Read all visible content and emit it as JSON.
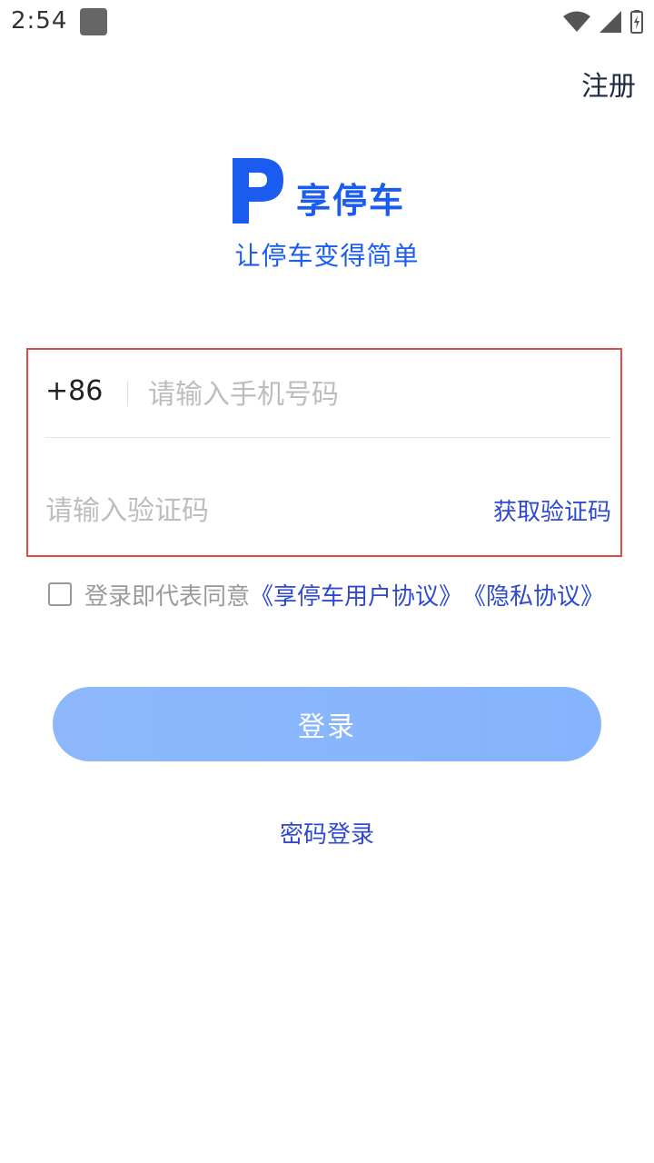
{
  "status_bar": {
    "time": "2:54",
    "icons": [
      "wifi-icon",
      "cellular-signal-icon",
      "battery-charging-icon"
    ]
  },
  "header": {
    "register_label": "注册"
  },
  "brand": {
    "logo_letter": "P",
    "app_name": "享停车",
    "slogan": "让停车变得简单",
    "color": "#1a5bf0"
  },
  "form": {
    "country_code": "+86",
    "phone_placeholder": "请输入手机号码",
    "code_placeholder": "请输入验证码",
    "get_code_label": "获取验证码"
  },
  "agreement": {
    "checked": false,
    "prefix": "登录即代表同意",
    "user_agreement": "《享停车用户协议》",
    "privacy_policy": "《隐私协议》"
  },
  "actions": {
    "login_label": "登录",
    "password_login_label": "密码登录"
  },
  "colors": {
    "accent": "#2f4ad0",
    "button": "#8cb8fb",
    "highlight_border": "#e54848"
  }
}
